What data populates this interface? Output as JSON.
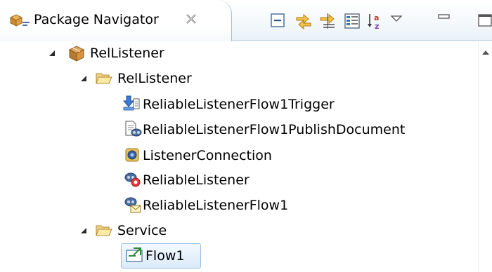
{
  "view": {
    "title": "Package Navigator",
    "close_glyph": "⨯",
    "toolbar": [
      {
        "name": "collapse-all-icon"
      },
      {
        "name": "link-with-editor-icon"
      },
      {
        "name": "filter-icon"
      },
      {
        "name": "show-details-icon"
      },
      {
        "name": "sort-alphabetically-icon"
      },
      {
        "name": "view-menu-icon"
      },
      {
        "name": "minimize-icon"
      },
      {
        "name": "maximize-icon"
      }
    ]
  },
  "tree": {
    "nodes": [
      {
        "label": "RelListener",
        "icon": "package-icon",
        "expanded": true
      },
      {
        "label": "RelListener",
        "icon": "folder-icon",
        "expanded": true
      },
      {
        "label": "ReliableListenerFlow1Trigger",
        "icon": "trigger-icon"
      },
      {
        "label": "ReliableListenerFlow1PublishDocument",
        "icon": "publish-document-icon"
      },
      {
        "label": "ListenerConnection",
        "icon": "connection-icon"
      },
      {
        "label": "ReliableListener",
        "icon": "listener-icon"
      },
      {
        "label": "ReliableListenerFlow1",
        "icon": "listener-notification-icon"
      },
      {
        "label": "Service",
        "icon": "folder-icon",
        "expanded": true
      },
      {
        "label": "Flow1",
        "icon": "flow-service-icon",
        "selected": true
      }
    ]
  }
}
